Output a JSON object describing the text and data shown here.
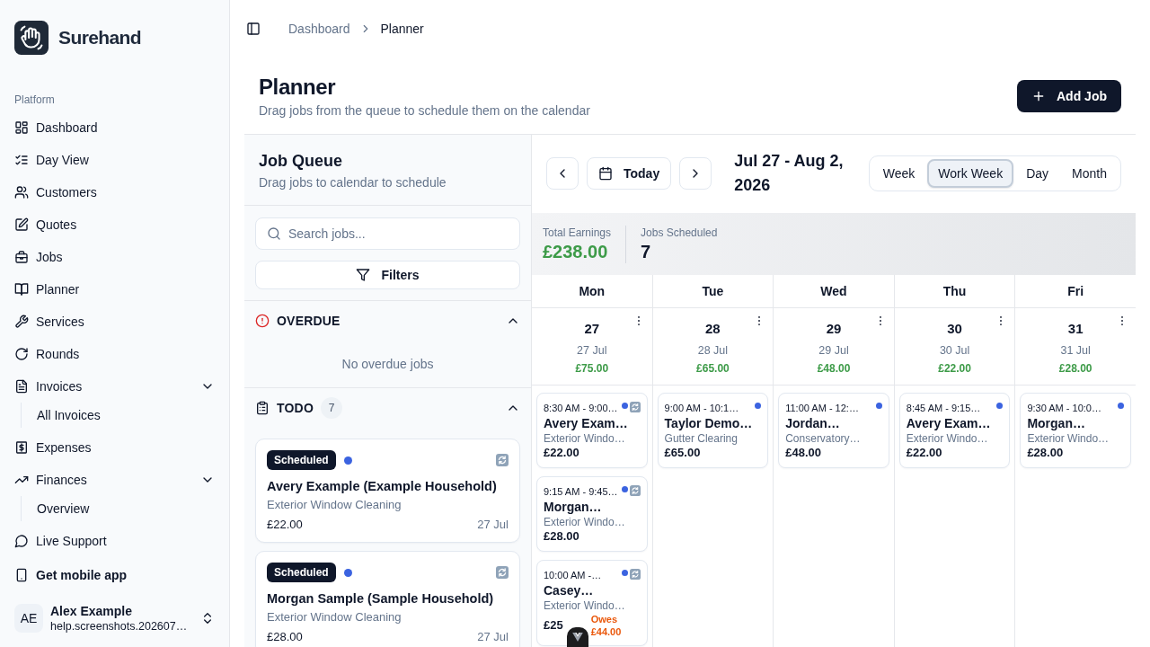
{
  "sidebar": {
    "brand": "Surehand",
    "group_label": "Platform",
    "items": [
      {
        "kind": "link",
        "label": "Dashboard"
      },
      {
        "kind": "link",
        "label": "Day View"
      },
      {
        "kind": "link",
        "label": "Customers"
      },
      {
        "kind": "link",
        "label": "Quotes"
      },
      {
        "kind": "link",
        "label": "Jobs"
      },
      {
        "kind": "link",
        "label": "Planner"
      },
      {
        "kind": "link",
        "label": "Services"
      },
      {
        "kind": "link",
        "label": "Rounds"
      },
      {
        "kind": "group",
        "label": "Invoices",
        "expanded": true,
        "children": [
          {
            "label": "All Invoices"
          }
        ]
      },
      {
        "kind": "link",
        "label": "Expenses"
      },
      {
        "kind": "group",
        "label": "Finances",
        "expanded": true,
        "children": [
          {
            "label": "Overview"
          }
        ]
      },
      {
        "kind": "link",
        "label": "Live Support"
      }
    ],
    "mobile_link": "Get mobile app",
    "user": {
      "initials": "AE",
      "name": "Alex Example",
      "email": "help.screenshots.202607…"
    }
  },
  "breadcrumb": [
    "Dashboard",
    "Planner"
  ],
  "page": {
    "title": "Planner",
    "subtitle": "Drag jobs from the queue to schedule them on the calendar",
    "add_button": "Add Job"
  },
  "job_queue": {
    "title": "Job Queue",
    "subtitle": "Drag jobs to calendar to schedule",
    "search": {
      "placeholder": "Search jobs..."
    },
    "filters_button": "Filters",
    "sections": [
      {
        "kind": "overdue",
        "title": "OVERDUE",
        "expanded": true,
        "empty_text": "No overdue jobs"
      },
      {
        "kind": "todo",
        "title": "TODO",
        "count": "7",
        "expanded": true,
        "jobs": [
          {
            "status": "Scheduled",
            "name": "Avery Example (Example Household)",
            "service": "Exterior Window Cleaning",
            "price": "£22.00",
            "date": "27 Jul",
            "recurring": true
          },
          {
            "status": "Scheduled",
            "name": "Morgan Sample (Sample Household)",
            "service": "Exterior Window Cleaning",
            "price": "£28.00",
            "date": "27 Jul",
            "recurring": true
          }
        ]
      }
    ]
  },
  "calendar": {
    "today_button": "Today",
    "date_range": "Jul 27 - Aug 2, 2026",
    "views": [
      {
        "label": "Week",
        "selected": false
      },
      {
        "label": "Work Week",
        "selected": true
      },
      {
        "label": "Day",
        "selected": false
      },
      {
        "label": "Month",
        "selected": false
      }
    ],
    "stats": [
      {
        "kind": "money",
        "label": "Total Earnings",
        "value": "£238.00"
      },
      {
        "kind": "count",
        "label": "Jobs Scheduled",
        "value": "7"
      }
    ],
    "days": [
      {
        "weekday": "Mon",
        "day": "27",
        "date": "27 Jul",
        "earnings": "£75.00",
        "events": [
          {
            "time": "8:30 AM - 9:00…",
            "client": "Avery Exam…",
            "service": "Exterior Windo…",
            "price": "£22.00",
            "recurring": true
          },
          {
            "time": "9:15 AM - 9:45…",
            "client": "Morgan…",
            "service": "Exterior Windo…",
            "price": "£28.00",
            "recurring": true
          },
          {
            "time": "10:00 AM -…",
            "client": "Casey…",
            "service": "Exterior Windo…",
            "price": "£25",
            "owes": "Owes £44.00",
            "recurring": true
          }
        ]
      },
      {
        "weekday": "Tue",
        "day": "28",
        "date": "28 Jul",
        "earnings": "£65.00",
        "events": [
          {
            "time": "9:00 AM - 10:1…",
            "client": "Taylor Demo…",
            "service": "Gutter Clearing",
            "price": "£65.00",
            "recurring": false
          }
        ]
      },
      {
        "weekday": "Wed",
        "day": "29",
        "date": "29 Jul",
        "earnings": "£48.00",
        "events": [
          {
            "time": "11:00 AM - 12:…",
            "client": "Jordan…",
            "service": "Conservatory…",
            "price": "£48.00",
            "recurring": false
          }
        ]
      },
      {
        "weekday": "Thu",
        "day": "30",
        "date": "30 Jul",
        "earnings": "£22.00",
        "events": [
          {
            "time": "8:45 AM - 9:15…",
            "client": "Avery Exam…",
            "service": "Exterior Windo…",
            "price": "£22.00",
            "recurring": false
          }
        ]
      },
      {
        "weekday": "Fri",
        "day": "31",
        "date": "31 Jul",
        "earnings": "£28.00",
        "events": [
          {
            "time": "9:30 AM - 10:0…",
            "client": "Morgan…",
            "service": "Exterior Windo…",
            "price": "£28.00",
            "recurring": false
          }
        ]
      }
    ]
  }
}
